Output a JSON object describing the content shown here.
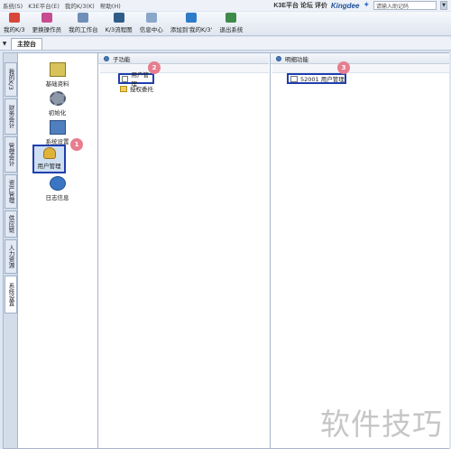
{
  "menubar": {
    "items": [
      "系统(S)",
      "K3E平台(E)",
      "我的K/3(K)",
      "帮助(H)"
    ],
    "brand_text": "K3E平台 论坛 评价",
    "kingdee": "Kingdee",
    "help_placeholder": "请输入助记码"
  },
  "toolbar": {
    "items": [
      {
        "label": "我的K/3",
        "icon": "home-icon"
      },
      {
        "label": "更换操作员",
        "icon": "user-switch-icon"
      },
      {
        "label": "我的工作台",
        "icon": "desk-icon"
      },
      {
        "label": "K/3流程图",
        "icon": "flowchart-icon"
      },
      {
        "label": "信息中心",
        "icon": "message-icon"
      },
      {
        "label": "添加到'我的K/3'",
        "icon": "add-favorite-icon"
      },
      {
        "label": "退出系统",
        "icon": "exit-icon"
      }
    ]
  },
  "tabs": {
    "main": "主控台"
  },
  "vertical_tabs": [
    "我的K/3",
    "财务会计",
    "管理会计",
    "资产管理",
    "供应链",
    "人力资源",
    "系统设置"
  ],
  "modules": [
    {
      "label": "基础资料",
      "icon": "basic-data-icon"
    },
    {
      "label": "初始化",
      "icon": "initialize-icon"
    },
    {
      "label": "系统设置",
      "icon": "system-settings-icon"
    },
    {
      "label": "用户管理",
      "icon": "user-management-icon"
    },
    {
      "label": "日志信息",
      "icon": "log-info-icon"
    }
  ],
  "subfunctions": {
    "header": "子功能",
    "items": [
      "用户管理",
      "授权委托"
    ]
  },
  "details": {
    "header": "明细功能",
    "items": [
      "52001 用户管理"
    ]
  },
  "badges": [
    "1",
    "2",
    "3"
  ],
  "watermark": "软件技巧",
  "colors": {
    "accent": "#1f3fae",
    "badge": "#e77d8f",
    "brand": "#1d4f99"
  }
}
